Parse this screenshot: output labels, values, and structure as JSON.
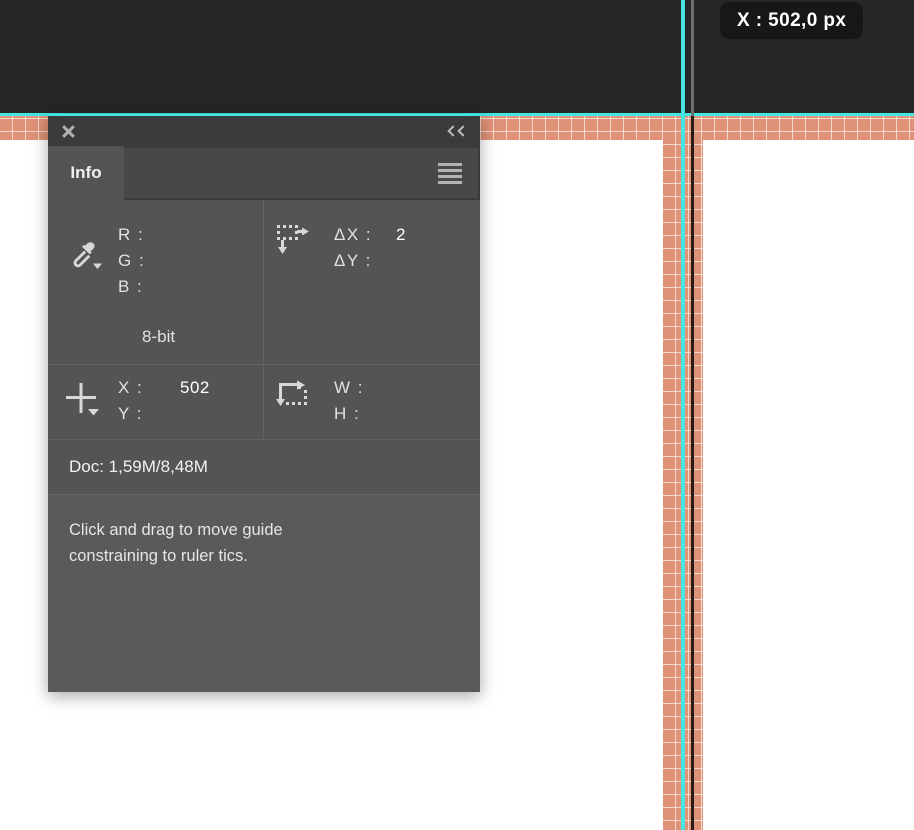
{
  "coord_tooltip": {
    "label": "X : 502,0 px"
  },
  "panel": {
    "title_tab": "Info",
    "close_icon": "close-icon",
    "collapse_icon": "double-chevron-left-icon",
    "menu_icon": "hamburger-menu-icon",
    "color_readout": {
      "icon": "eyedropper-icon",
      "rows": [
        {
          "label": "R :",
          "value": ""
        },
        {
          "label": "G :",
          "value": ""
        },
        {
          "label": "B :",
          "value": ""
        }
      ],
      "bit_depth": "8-bit"
    },
    "delta_readout": {
      "icon": "delta-move-icon",
      "rows": [
        {
          "label": "ΔX :",
          "value": "2"
        },
        {
          "label": "ΔY :",
          "value": ""
        }
      ]
    },
    "position_readout": {
      "icon": "crosshair-icon",
      "rows": [
        {
          "label": "X :",
          "value": "502"
        },
        {
          "label": "Y :",
          "value": ""
        }
      ]
    },
    "size_readout": {
      "icon": "bounds-icon",
      "rows": [
        {
          "label": "W :",
          "value": ""
        },
        {
          "label": "H :",
          "value": ""
        }
      ]
    },
    "doc_size": "Doc: 1,59M/8,48M",
    "hint": "Click and drag to move guide constraining to ruler tics."
  },
  "colors": {
    "guide": "#45e6e2",
    "artwork": "#df9278",
    "panel_bg": "#545454",
    "chrome": "#262626",
    "badge_bg": "#171717"
  }
}
